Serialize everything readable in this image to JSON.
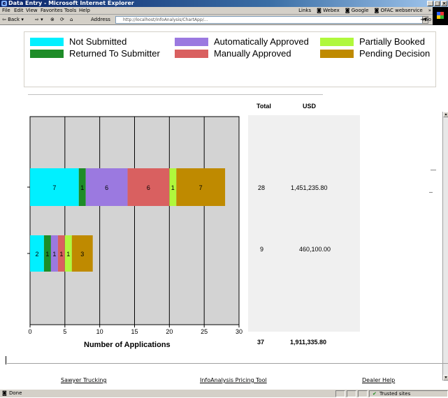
{
  "window": {
    "title": "Data Entry - Microsoft Internet Explorer",
    "buttons": [
      "_",
      "□",
      "×"
    ]
  },
  "menu": {
    "items": [
      "File",
      "Edit",
      "View",
      "Favorites",
      "Tools",
      "Help"
    ],
    "links_label": "Links",
    "links": [
      "Webex",
      "Google",
      "OFAC webservice"
    ],
    "more": "»"
  },
  "toolbar": {
    "back": "Back",
    "address_label": "Address",
    "address_value": "http://localhost/InfoAnalysis/ChartApp/...",
    "go": "Go"
  },
  "legend": [
    {
      "label": "Not Submitted",
      "color": "#00f0ff"
    },
    {
      "label": "Automatically Approved",
      "color": "#9b79e0"
    },
    {
      "label": "Partially Booked",
      "color": "#b0f83c"
    },
    {
      "label": "Returned To Submitter",
      "color": "#1e8c28"
    },
    {
      "label": "Manually Approved",
      "color": "#d96060"
    },
    {
      "label": "Pending Decision",
      "color": "#bf8a00"
    }
  ],
  "table": {
    "total_header": "Total",
    "usd_header": "USD",
    "rows": [
      {
        "total": "28",
        "usd": "1,451,235.80"
      },
      {
        "total": "9",
        "usd": "460,100.00"
      }
    ],
    "grand_total": "37",
    "grand_usd": "1,911,335.80"
  },
  "chart_data": {
    "type": "bar",
    "orientation": "horizontal-stacked",
    "xlabel": "Number of Applications",
    "xlim": [
      0,
      30
    ],
    "xticks": [
      "0",
      "5",
      "10",
      "15",
      "20",
      "25",
      "30"
    ],
    "grid": true,
    "series_order": [
      "Not Submitted",
      "Returned To Submitter",
      "Automatically Approved",
      "Manually Approved",
      "Partially Booked",
      "Pending Decision"
    ],
    "bars": [
      {
        "values": [
          7,
          1,
          6,
          6,
          1,
          7
        ]
      },
      {
        "values": [
          2,
          1,
          1,
          1,
          1,
          3
        ]
      }
    ]
  },
  "footer": {
    "links": [
      "Sawyer Trucking",
      "InfoAnalysis Pricing Tool",
      "Dealer Help"
    ]
  },
  "status": {
    "text": "Done",
    "zone": "Trusted sites"
  }
}
